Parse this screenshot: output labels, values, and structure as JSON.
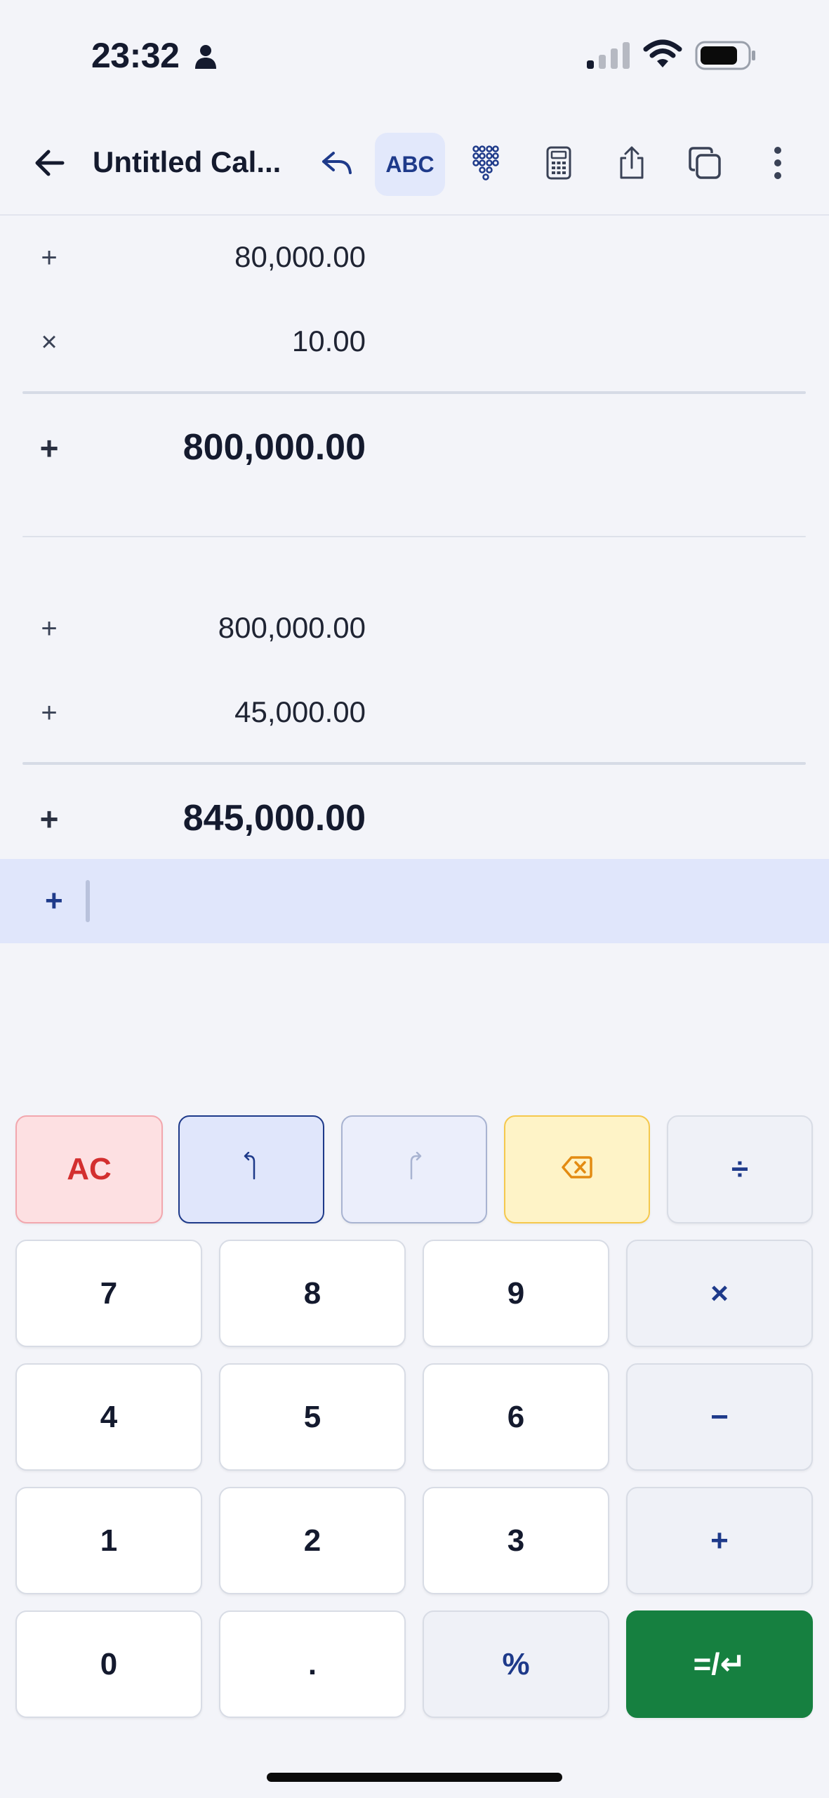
{
  "status_bar": {
    "time": "23:32",
    "icons": [
      "person-icon",
      "cellular-signal-icon",
      "wifi-icon",
      "battery-icon"
    ]
  },
  "toolbar": {
    "title": "Untitled Cal...",
    "abc_label": "ABC",
    "icons": [
      "back-arrow-icon",
      "undo-arrow-icon",
      "dialpad-icon",
      "calculator-icon",
      "share-icon",
      "copy-icon",
      "more-vertical-icon"
    ]
  },
  "tape": {
    "rows": [
      {
        "op": "+",
        "value": "80,000.00"
      },
      {
        "op": "×",
        "value": "10.00"
      },
      {
        "op": "+",
        "value": "800,000.00",
        "total": true
      },
      {
        "op": "+",
        "value": "800,000.00"
      },
      {
        "op": "+",
        "value": "45,000.00"
      },
      {
        "op": "+",
        "value": "845,000.00",
        "total": true
      }
    ]
  },
  "input": {
    "op": "+",
    "value": ""
  },
  "keypad": {
    "top_row": [
      "AC",
      "↰",
      "↱",
      "⌫",
      "÷"
    ],
    "rows": [
      [
        "7",
        "8",
        "9",
        "×"
      ],
      [
        "4",
        "5",
        "6",
        "−"
      ],
      [
        "1",
        "2",
        "3",
        "+"
      ],
      [
        "0",
        ".",
        "%",
        "=/↵"
      ]
    ]
  },
  "colors": {
    "accent": "#1e3a8a",
    "equals": "#168040",
    "clear": "#d32f2f",
    "backspace": "#e38b12",
    "input_highlight": "#e0e6fb"
  }
}
